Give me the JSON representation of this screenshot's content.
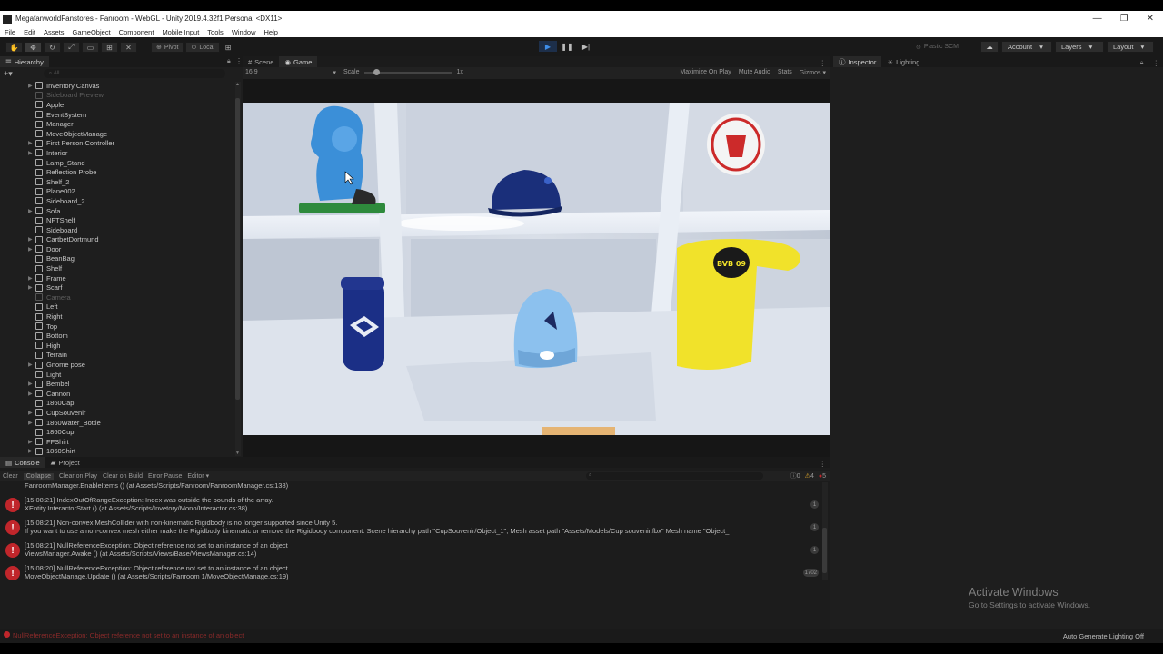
{
  "window": {
    "title": "MegafanworldFanstores - Fanroom - WebGL - Unity 2019.4.32f1 Personal <DX11>",
    "minimize": "—",
    "restore": "❐",
    "close": "✕"
  },
  "menu": [
    "File",
    "Edit",
    "Assets",
    "GameObject",
    "Component",
    "Mobile Input",
    "Tools",
    "Window",
    "Help"
  ],
  "toolbar": {
    "pivot": "Pivot",
    "local": "Local",
    "plastic": "Plastic SCM",
    "account": "Account",
    "layers": "Layers",
    "layout": "Layout"
  },
  "hierarchy": {
    "tab": "Hierarchy",
    "search_placeholder": "All",
    "items": [
      {
        "name": "Inventory Canvas",
        "fold": true,
        "dim": false
      },
      {
        "name": "Sideboard Preview",
        "fold": false,
        "dim": true
      },
      {
        "name": "Apple",
        "fold": false,
        "dim": false
      },
      {
        "name": "EventSystem",
        "fold": false,
        "dim": false
      },
      {
        "name": "Manager",
        "fold": false,
        "dim": false
      },
      {
        "name": "MoveObjectManage",
        "fold": false,
        "dim": false
      },
      {
        "name": "First Person Controller",
        "fold": true,
        "dim": false
      },
      {
        "name": "Interior",
        "fold": true,
        "dim": false
      },
      {
        "name": "Lamp_Stand",
        "fold": false,
        "dim": false
      },
      {
        "name": "Reflection Probe",
        "fold": false,
        "dim": false
      },
      {
        "name": "Shelf_2",
        "fold": false,
        "dim": false
      },
      {
        "name": "Plane002",
        "fold": false,
        "dim": false
      },
      {
        "name": "Sideboard_2",
        "fold": false,
        "dim": false
      },
      {
        "name": "Sofa",
        "fold": true,
        "dim": false
      },
      {
        "name": "NFTShelf",
        "fold": false,
        "dim": false
      },
      {
        "name": "Sideboard",
        "fold": false,
        "dim": false
      },
      {
        "name": "CartbetDortmund",
        "fold": true,
        "dim": false
      },
      {
        "name": "Door",
        "fold": true,
        "dim": false
      },
      {
        "name": "BeanBag",
        "fold": false,
        "dim": false
      },
      {
        "name": "Shelf",
        "fold": false,
        "dim": false
      },
      {
        "name": "Frame",
        "fold": true,
        "dim": false
      },
      {
        "name": "Scarf",
        "fold": true,
        "dim": false
      },
      {
        "name": "Camera",
        "fold": false,
        "dim": true
      },
      {
        "name": "Left",
        "fold": false,
        "dim": false
      },
      {
        "name": "Right",
        "fold": false,
        "dim": false
      },
      {
        "name": "Top",
        "fold": false,
        "dim": false
      },
      {
        "name": "Bottom",
        "fold": false,
        "dim": false
      },
      {
        "name": "High",
        "fold": false,
        "dim": false
      },
      {
        "name": "Terrain",
        "fold": false,
        "dim": false
      },
      {
        "name": "Gnome pose",
        "fold": true,
        "dim": false
      },
      {
        "name": "Light",
        "fold": false,
        "dim": false
      },
      {
        "name": "Bembel",
        "fold": true,
        "dim": false
      },
      {
        "name": "Cannon",
        "fold": true,
        "dim": false
      },
      {
        "name": "1860Cap",
        "fold": false,
        "dim": false
      },
      {
        "name": "CupSouvenir",
        "fold": true,
        "dim": false
      },
      {
        "name": "1860Water_Bottle",
        "fold": true,
        "dim": false
      },
      {
        "name": "1860Cup",
        "fold": false,
        "dim": false
      },
      {
        "name": "FFShirt",
        "fold": true,
        "dim": false
      },
      {
        "name": "1860Shirt",
        "fold": true,
        "dim": false
      }
    ]
  },
  "game": {
    "tab_scene": "Scene",
    "tab_game": "Game",
    "aspect": "16:9",
    "scale_label": "Scale",
    "scale_value": "1x",
    "maximize": "Maximize On Play",
    "mute": "Mute Audio",
    "stats": "Stats",
    "gizmos": "Gizmos",
    "shirt_text": "BVB 09"
  },
  "inspector": {
    "tab_inspector": "Inspector",
    "tab_lighting": "Lighting",
    "watermark_title": "Activate Windows",
    "watermark_sub": "Go to Settings to activate Windows."
  },
  "console": {
    "tab_console": "Console",
    "tab_project": "Project",
    "clear": "Clear",
    "collapse": "Collapse",
    "clear_on_play": "Clear on Play",
    "clear_on_build": "Clear on Build",
    "error_pause": "Error Pause",
    "editor": "Editor",
    "count_info": "0",
    "count_warn": "4",
    "count_error": "5",
    "top_partial": "FanroomManager.EnableItems () (at Assets/Scripts/Fanroom/FanroomManager.cs:138)",
    "logs": [
      {
        "l1": "[15:08:21] IndexOutOfRangeException: Index was outside the bounds of the array.",
        "l2": "XEntity.InteractorStart () (at Assets/Scripts/Invetory/Mono/Interactor.cs:38)",
        "count": "1"
      },
      {
        "l1": "[15:08:21] Non-convex MeshCollider with non-kinematic Rigidbody is no longer supported since Unity 5.",
        "l2": "If you want to use a non-convex mesh either make the Rigidbody kinematic or remove the Rigidbody component. Scene hierarchy path \"CupSouvenir/Object_1\", Mesh asset path \"Assets/Models/Cup souvenir.fbx\" Mesh name \"Object_",
        "count": "1"
      },
      {
        "l1": "[15:08:21] NullReferenceException: Object reference not set to an instance of an object",
        "l2": "ViewsManager.Awake () (at Assets/Scripts/Views/Base/ViewsManager.cs:14)",
        "count": "1"
      },
      {
        "l1": "[15:08:20] NullReferenceException: Object reference not set to an instance of an object",
        "l2": "MoveObjectManage.Update () (at Assets/Scripts/Fanroom 1/MoveObjectManage.cs:19)",
        "count": "1702"
      }
    ]
  },
  "status": {
    "message": "NullReferenceException: Object reference not set to an instance of an object",
    "right": "Auto Generate Lighting Off"
  },
  "colors": {
    "accent": "#3e8ee9",
    "error": "#c0262b",
    "warn": "#e0a82a"
  }
}
